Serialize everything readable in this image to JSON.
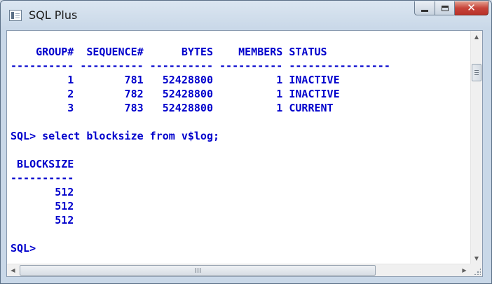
{
  "window": {
    "title": "SQL Plus",
    "controls": {
      "minimize_icon": "minimize-icon",
      "maximize_icon": "maximize-icon",
      "close_icon": "close-icon"
    }
  },
  "console": {
    "lines": [
      "",
      "    GROUP#  SEQUENCE#      BYTES    MEMBERS STATUS",
      "---------- ---------- ---------- ---------- ----------------",
      "         1        781   52428800          1 INACTIVE",
      "         2        782   52428800          1 INACTIVE",
      "         3        783   52428800          1 CURRENT",
      "",
      "SQL> select blocksize from v$log;",
      "",
      " BLOCKSIZE",
      "----------",
      "       512",
      "       512",
      "       512",
      "",
      "SQL>"
    ]
  },
  "colors": {
    "console_text": "#0000cc",
    "console_background": "#ffffff",
    "close_button": "#c7443a"
  }
}
